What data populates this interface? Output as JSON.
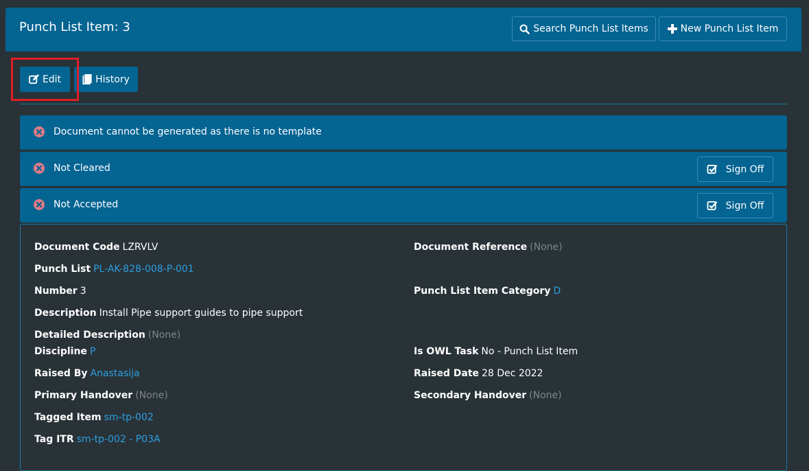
{
  "header": {
    "title": "Punch List Item: 3",
    "search_label": "Search Punch List Items",
    "new_label": "New Punch List Item"
  },
  "toolbar": {
    "edit_label": "Edit",
    "history_label": "History"
  },
  "statuses": [
    {
      "text": "Document cannot be generated as there is no template"
    },
    {
      "text": "Not Cleared",
      "action": "Sign Off"
    },
    {
      "text": "Not Accepted",
      "action": "Sign Off"
    }
  ],
  "details": {
    "document_code": {
      "label": "Document Code",
      "value": "LZRVLV"
    },
    "document_reference": {
      "label": "Document Reference",
      "value": "(None)"
    },
    "punch_list": {
      "label": "Punch List",
      "value": "PL-AK-828-008-P-001"
    },
    "number": {
      "label": "Number",
      "value": "3"
    },
    "category": {
      "label": "Punch List Item Category",
      "value": "D"
    },
    "description": {
      "label": "Description",
      "value": "Install Pipe support guides to pipe support"
    },
    "detailed_description": {
      "label": "Detailed Description",
      "value": "(None)"
    },
    "discipline": {
      "label": "Discipline",
      "value": "P"
    },
    "is_owl_task": {
      "label": "Is OWL Task",
      "value": "No - Punch List Item"
    },
    "raised_by": {
      "label": "Raised By",
      "value": "Anastasija"
    },
    "raised_date": {
      "label": "Raised Date",
      "value": "28 Dec 2022"
    },
    "primary_handover": {
      "label": "Primary Handover",
      "value": "(None)"
    },
    "secondary_handover": {
      "label": "Secondary Handover",
      "value": "(None)"
    },
    "tagged_item": {
      "label": "Tagged Item",
      "value": "sm-tp-002"
    },
    "tag_itr": {
      "label": "Tag ITR",
      "value": "sm-tp-002 - P03A"
    }
  },
  "colors": {
    "background": "#293237",
    "primary": "#046492",
    "link": "#2c9fe0",
    "muted": "#7d858a",
    "error_icon": "#e07a86",
    "highlight": "#e21f26"
  }
}
